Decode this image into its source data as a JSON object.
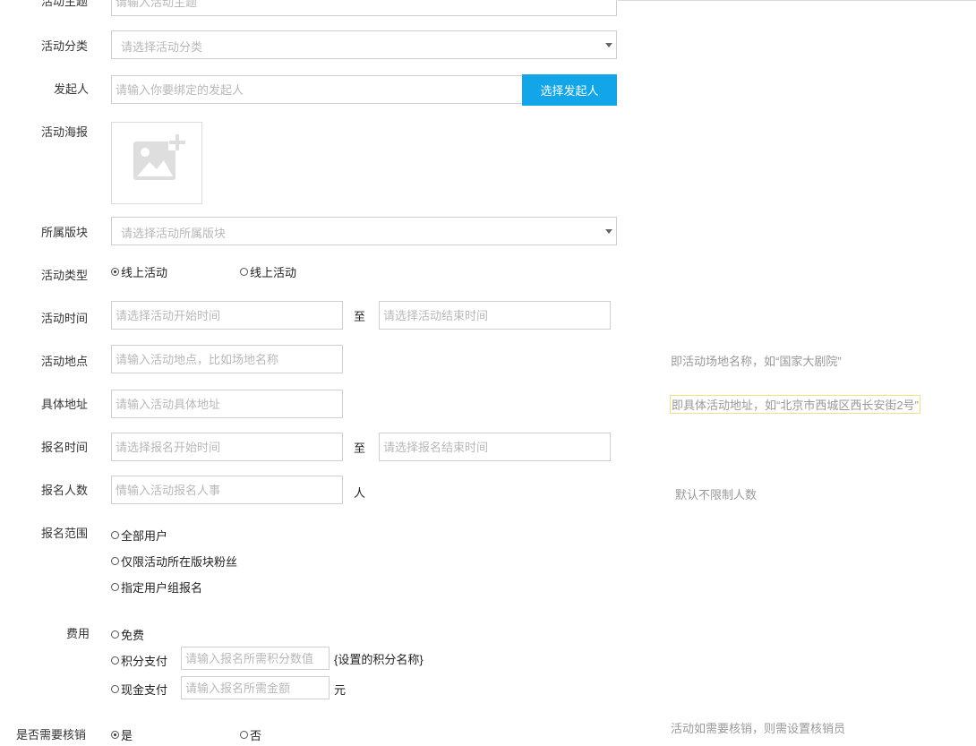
{
  "theme": {
    "label": "活动主题",
    "placeholder": "请输入活动主题"
  },
  "category": {
    "label": "活动分类",
    "placeholder": "请选择活动分类"
  },
  "initiator": {
    "label": "发起人",
    "placeholder": "请输入你要绑定的发起人",
    "button": "选择发起人"
  },
  "poster": {
    "label": "活动海报"
  },
  "section": {
    "label": "所属版块",
    "placeholder": "请选择活动所属版块"
  },
  "type": {
    "label": "活动类型",
    "options": [
      "线上活动",
      "线上活动"
    ],
    "selected": 0
  },
  "time": {
    "label": "活动时间",
    "start_placeholder": "请选择活动开始时间",
    "to": "至",
    "end_placeholder": "请选择活动结束时间"
  },
  "venue": {
    "label": "活动地点",
    "placeholder": "请输入活动地点，比如场地名称",
    "hint": "即活动场地名称，如“国家大剧院”"
  },
  "address": {
    "label": "具体地址",
    "placeholder": "请输入活动具体地址",
    "hint": "即具体活动地址，如“北京市西城区西长安街2号”"
  },
  "signup_time": {
    "label": "报名时间",
    "start_placeholder": "请选择报名开始时间",
    "to": "至",
    "end_placeholder": "请选择报名结束时间"
  },
  "signup_count": {
    "label": "报名人数",
    "placeholder": "情输入活动报名人事",
    "unit": "人",
    "hint": "默认不限制人数"
  },
  "scope": {
    "label": "报名范围",
    "options": [
      "全部用户",
      "仅限活动所在版块粉丝",
      "指定用户组报名"
    ]
  },
  "fee": {
    "label": "费用",
    "free": "免费",
    "points": "积分支付",
    "points_placeholder": "请输入报名所需积分数值",
    "points_unit": "{设置的积分名称}",
    "cash": "现金支付",
    "cash_placeholder": "请输入报名所需金额",
    "cash_unit": "元"
  },
  "verify": {
    "label": "是否需要核销",
    "yes": "是",
    "no": "否",
    "hint": "活动如需要核销，则需设置核销员"
  },
  "colors": {
    "accent": "#12a5e8",
    "hint": "#999999",
    "border": "#cfcfcf"
  }
}
